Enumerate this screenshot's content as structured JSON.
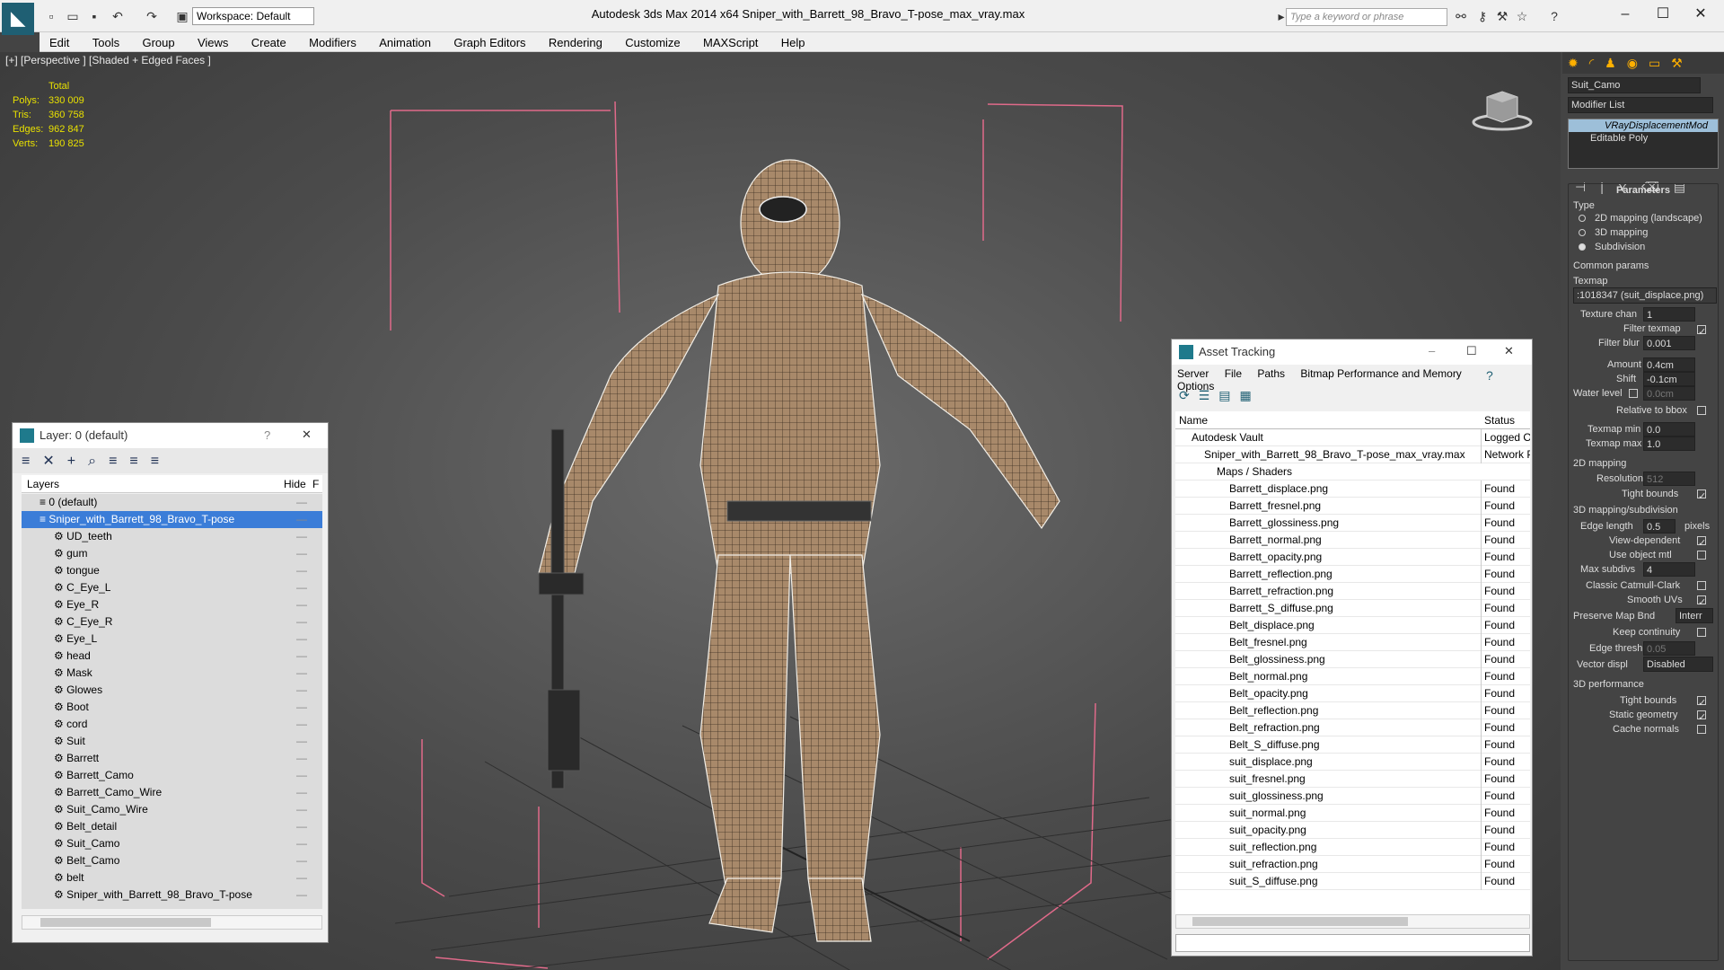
{
  "app": {
    "title": "Autodesk 3ds Max  2014 x64      Sniper_with_Barrett_98_Bravo_T-pose_max_vray.max",
    "workspace": "Workspace: Default",
    "search_placeholder": "Type a keyword or phrase"
  },
  "menu": [
    "Edit",
    "Tools",
    "Group",
    "Views",
    "Create",
    "Modifiers",
    "Animation",
    "Graph Editors",
    "Rendering",
    "Customize",
    "MAXScript",
    "Help"
  ],
  "viewport": {
    "label": "[+] [Perspective ] [Shaded + Edged Faces ]",
    "stats_header": "Total",
    "stats": [
      {
        "k": "Polys:",
        "v": "330 009"
      },
      {
        "k": "Tris:",
        "v": "360 758"
      },
      {
        "k": "Edges:",
        "v": "962 847"
      },
      {
        "k": "Verts:",
        "v": "190 825"
      }
    ]
  },
  "layers": {
    "title": "Layer: 0 (default)",
    "col_layers": "Layers",
    "col_hide": "Hide",
    "col_f": "F",
    "items": [
      {
        "name": "0 (default)",
        "level": 0,
        "selected": false
      },
      {
        "name": "Sniper_with_Barrett_98_Bravo_T-pose",
        "level": 0,
        "selected": true
      },
      {
        "name": "UD_teeth",
        "level": 1
      },
      {
        "name": "gum",
        "level": 1
      },
      {
        "name": "tongue",
        "level": 1
      },
      {
        "name": "C_Eye_L",
        "level": 1
      },
      {
        "name": "Eye_R",
        "level": 1
      },
      {
        "name": "C_Eye_R",
        "level": 1
      },
      {
        "name": "Eye_L",
        "level": 1
      },
      {
        "name": "head",
        "level": 1
      },
      {
        "name": "Mask",
        "level": 1
      },
      {
        "name": "Glowes",
        "level": 1
      },
      {
        "name": "Boot",
        "level": 1
      },
      {
        "name": "cord",
        "level": 1
      },
      {
        "name": "Suit",
        "level": 1
      },
      {
        "name": "Barrett",
        "level": 1
      },
      {
        "name": "Barrett_Camo",
        "level": 1
      },
      {
        "name": "Barrett_Camo_Wire",
        "level": 1
      },
      {
        "name": "Suit_Camo_Wire",
        "level": 1
      },
      {
        "name": "Belt_detail",
        "level": 1
      },
      {
        "name": "Suit_Camo",
        "level": 1
      },
      {
        "name": "Belt_Camo",
        "level": 1
      },
      {
        "name": "belt",
        "level": 1
      },
      {
        "name": "Sniper_with_Barrett_98_Bravo_T-pose",
        "level": 1
      }
    ]
  },
  "asset": {
    "title": "Asset Tracking",
    "menu": [
      "Server",
      "File",
      "Paths",
      "Bitmap Performance and Memory",
      "Options"
    ],
    "col_name": "Name",
    "col_status": "Status",
    "rows": [
      {
        "name": "Autodesk Vault",
        "status": "Logged Ou",
        "indent": 1
      },
      {
        "name": "Sniper_with_Barrett_98_Bravo_T-pose_max_vray.max",
        "status": "Network P.",
        "indent": 2
      },
      {
        "name": "Maps / Shaders",
        "status": "",
        "indent": 3
      },
      {
        "name": "Barrett_displace.png",
        "status": "Found",
        "indent": 4
      },
      {
        "name": "Barrett_fresnel.png",
        "status": "Found",
        "indent": 4
      },
      {
        "name": "Barrett_glossiness.png",
        "status": "Found",
        "indent": 4
      },
      {
        "name": "Barrett_normal.png",
        "status": "Found",
        "indent": 4
      },
      {
        "name": "Barrett_opacity.png",
        "status": "Found",
        "indent": 4
      },
      {
        "name": "Barrett_reflection.png",
        "status": "Found",
        "indent": 4
      },
      {
        "name": "Barrett_refraction.png",
        "status": "Found",
        "indent": 4
      },
      {
        "name": "Barrett_S_diffuse.png",
        "status": "Found",
        "indent": 4
      },
      {
        "name": "Belt_displace.png",
        "status": "Found",
        "indent": 4
      },
      {
        "name": "Belt_fresnel.png",
        "status": "Found",
        "indent": 4
      },
      {
        "name": "Belt_glossiness.png",
        "status": "Found",
        "indent": 4
      },
      {
        "name": "Belt_normal.png",
        "status": "Found",
        "indent": 4
      },
      {
        "name": "Belt_opacity.png",
        "status": "Found",
        "indent": 4
      },
      {
        "name": "Belt_reflection.png",
        "status": "Found",
        "indent": 4
      },
      {
        "name": "Belt_refraction.png",
        "status": "Found",
        "indent": 4
      },
      {
        "name": "Belt_S_diffuse.png",
        "status": "Found",
        "indent": 4
      },
      {
        "name": "suit_displace.png",
        "status": "Found",
        "indent": 4
      },
      {
        "name": "suit_fresnel.png",
        "status": "Found",
        "indent": 4
      },
      {
        "name": "suit_glossiness.png",
        "status": "Found",
        "indent": 4
      },
      {
        "name": "suit_normal.png",
        "status": "Found",
        "indent": 4
      },
      {
        "name": "suit_opacity.png",
        "status": "Found",
        "indent": 4
      },
      {
        "name": "suit_reflection.png",
        "status": "Found",
        "indent": 4
      },
      {
        "name": "suit_refraction.png",
        "status": "Found",
        "indent": 4
      },
      {
        "name": "suit_S_diffuse.png",
        "status": "Found",
        "indent": 4
      }
    ]
  },
  "cmd": {
    "object_name": "Suit_Camo",
    "modifier_list": "Modifier List",
    "stack": [
      "VRayDisplacementMod",
      "Editable Poly"
    ],
    "rollout_params": "Parameters",
    "type_label": "Type",
    "type_opts": [
      "2D mapping (landscape)",
      "3D mapping",
      "Subdivision"
    ],
    "common": "Common params",
    "texmap_label": "Texmap",
    "texmap_val": ":1018347 (suit_displace.png)",
    "tex_chan_lbl": "Texture chan",
    "tex_chan": "1",
    "filter_texmap": "Filter texmap",
    "filter_blur_lbl": "Filter blur",
    "filter_blur": "0.001",
    "amount_lbl": "Amount",
    "amount": "0.4cm",
    "shift_lbl": "Shift",
    "shift": "-0.1cm",
    "water_lbl": "Water level",
    "water": "0.0cm",
    "rel_bbox": "Relative to bbox",
    "texmin_lbl": "Texmap min",
    "texmin": "0.0",
    "texmax_lbl": "Texmap max",
    "texmax": "1.0",
    "map2d": "2D mapping",
    "res_lbl": "Resolution",
    "res": "512",
    "tight": "Tight bounds",
    "map3d": "3D mapping/subdivision",
    "edge_lbl": "Edge length",
    "edge": "0.5",
    "pixels": "pixels",
    "view_dep": "View-dependent",
    "use_obj": "Use object mtl",
    "maxsub_lbl": "Max subdivs",
    "maxsub": "4",
    "catmull": "Classic Catmull-Clark",
    "smooth": "Smooth UVs",
    "pmb_lbl": "Preserve Map Bnd",
    "pmb": "Interr",
    "keep": "Keep continuity",
    "et_lbl": "Edge thresh",
    "et": "0.05",
    "vd_lbl": "Vector displ",
    "vd": "Disabled",
    "perf": "3D performance",
    "tight2": "Tight bounds",
    "static": "Static geometry",
    "cache": "Cache normals"
  }
}
